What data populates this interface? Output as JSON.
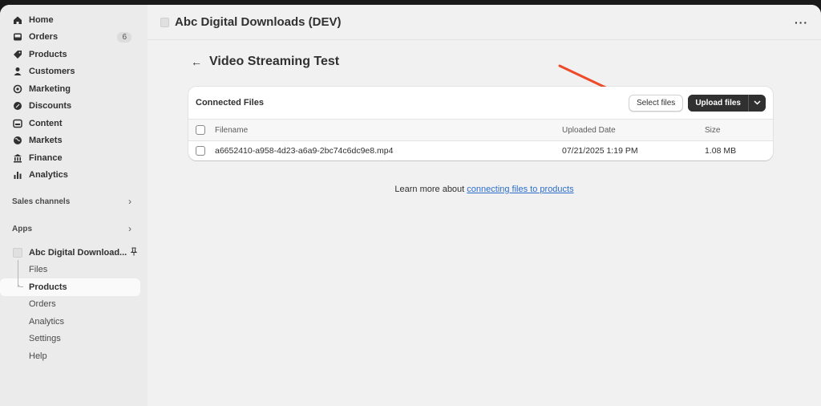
{
  "sidebar": {
    "items": [
      {
        "label": "Home",
        "icon": "home-icon"
      },
      {
        "label": "Orders",
        "icon": "inbox-icon",
        "badge": "6"
      },
      {
        "label": "Products",
        "icon": "tag-icon"
      },
      {
        "label": "Customers",
        "icon": "person-icon"
      },
      {
        "label": "Marketing",
        "icon": "target-icon"
      },
      {
        "label": "Discounts",
        "icon": "discount-icon"
      },
      {
        "label": "Content",
        "icon": "content-icon"
      },
      {
        "label": "Markets",
        "icon": "globe-icon"
      },
      {
        "label": "Finance",
        "icon": "bank-icon"
      },
      {
        "label": "Analytics",
        "icon": "chart-icon"
      }
    ],
    "sales_channels_label": "Sales channels",
    "apps_label": "Apps",
    "app": {
      "name": "Abc Digital Download...",
      "subitems": [
        "Files",
        "Products",
        "Orders",
        "Analytics",
        "Settings",
        "Help"
      ],
      "active_subitem": "Products"
    }
  },
  "topbar": {
    "title": "Abc Digital Downloads (DEV)"
  },
  "page": {
    "title": "Video Streaming Test"
  },
  "card": {
    "title": "Connected Files",
    "select_label": "Select files",
    "upload_label": "Upload files",
    "columns": [
      "Filename",
      "Uploaded Date",
      "Size"
    ],
    "rows": [
      {
        "filename": "a6652410-a958-4d23-a6a9-2bc74c6dc9e8.mp4",
        "date": "07/21/2025 1:19 PM",
        "size": "1.08 MB"
      }
    ]
  },
  "footer": {
    "prefix": "Learn more about",
    "link": "connecting files to products"
  },
  "colors": {
    "accent_arrow": "#ee4b2b",
    "primary_button": "#303030",
    "link": "#2c6ecb"
  }
}
